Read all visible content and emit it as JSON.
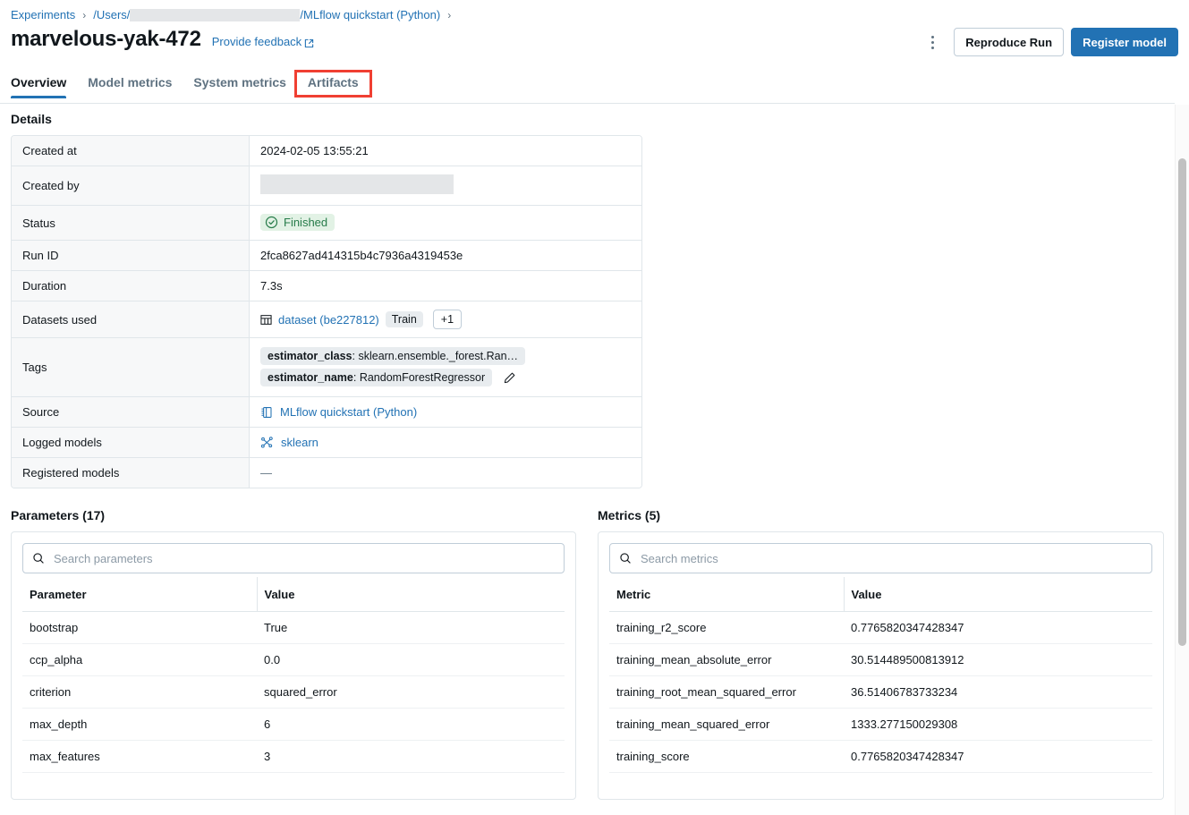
{
  "breadcrumb": {
    "root": "Experiments",
    "separator": "›",
    "users_prefix": "/Users/",
    "experiment": "/MLflow quickstart (Python)",
    "trailing_separator": "›"
  },
  "header": {
    "title": "marvelous-yak-472",
    "feedback_label": "Provide feedback",
    "kebab_name": "more-options",
    "reproduce_label": "Reproduce Run",
    "register_label": "Register model"
  },
  "tabs": [
    {
      "label": "Overview",
      "name": "overview",
      "active": true,
      "highlighted": false
    },
    {
      "label": "Model metrics",
      "name": "model-metrics",
      "active": false,
      "highlighted": false
    },
    {
      "label": "System metrics",
      "name": "system-metrics",
      "active": false,
      "highlighted": false
    },
    {
      "label": "Artifacts",
      "name": "artifacts",
      "active": false,
      "highlighted": true
    }
  ],
  "details": {
    "heading": "Details",
    "rows": {
      "created_at": {
        "label": "Created at",
        "value": "2024-02-05 13:55:21"
      },
      "created_by": {
        "label": "Created by",
        "value": ""
      },
      "status": {
        "label": "Status",
        "value": "Finished"
      },
      "run_id": {
        "label": "Run ID",
        "value": "2fca8627ad414315b4c7936a4319453e"
      },
      "duration": {
        "label": "Duration",
        "value": "7.3s"
      },
      "datasets": {
        "label": "Datasets used",
        "link": "dataset (be227812)",
        "chip": "Train",
        "more": "+1"
      },
      "tags": {
        "label": "Tags",
        "items": [
          {
            "key": "estimator_class",
            "value": "sklearn.ensemble._forest.Ran…"
          },
          {
            "key": "estimator_name",
            "value": "RandomForestRegressor"
          }
        ]
      },
      "source": {
        "label": "Source",
        "value": "MLflow quickstart (Python)"
      },
      "logged_models": {
        "label": "Logged models",
        "value": "sklearn"
      },
      "registered_models": {
        "label": "Registered models",
        "value": "—"
      }
    }
  },
  "parameters": {
    "heading": "Parameters (17)",
    "search_placeholder": "Search parameters",
    "search_value": "",
    "columns": [
      "Parameter",
      "Value"
    ],
    "rows": [
      {
        "name": "bootstrap",
        "value": "True"
      },
      {
        "name": "ccp_alpha",
        "value": "0.0"
      },
      {
        "name": "criterion",
        "value": "squared_error"
      },
      {
        "name": "max_depth",
        "value": "6"
      },
      {
        "name": "max_features",
        "value": "3"
      }
    ]
  },
  "metrics": {
    "heading": "Metrics (5)",
    "search_placeholder": "Search metrics",
    "search_value": "",
    "columns": [
      "Metric",
      "Value"
    ],
    "rows": [
      {
        "name": "training_r2_score",
        "value": "0.7765820347428347"
      },
      {
        "name": "training_mean_absolute_error",
        "value": "30.514489500813912"
      },
      {
        "name": "training_root_mean_squared_error",
        "value": "36.51406783733234"
      },
      {
        "name": "training_mean_squared_error",
        "value": "1333.277150029308"
      },
      {
        "name": "training_score",
        "value": "0.7765820347428347"
      }
    ]
  },
  "colors": {
    "accent": "#2272b4",
    "highlight": "#f03f32",
    "status_green": "#277c4a",
    "status_green_bg": "#e2f2e5",
    "border": "#e0e6ea",
    "label_bg": "#f7f8f9"
  }
}
